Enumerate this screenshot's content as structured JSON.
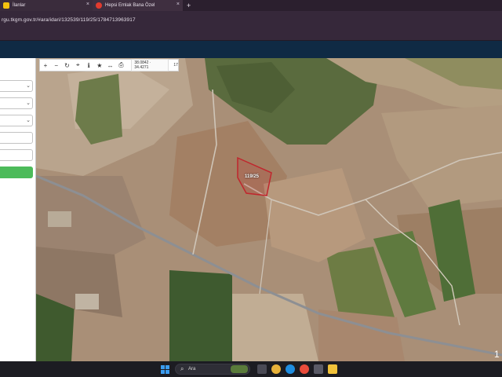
{
  "browser": {
    "tabs": [
      {
        "title": "İlanlar",
        "icon": "sahibinden-icon"
      },
      {
        "title": "Hepsi Emlak Bana Özel",
        "icon": "hepsiemlak-icon"
      }
    ],
    "new_tab_label": "+",
    "tab_close_glyph": "×",
    "url": "rgu.tkgm.gov.tr/#ara/idari/132539/119/25/1784713963917"
  },
  "map": {
    "toolbar": {
      "tools": [
        {
          "name": "zoom-in-icon",
          "glyph": "+"
        },
        {
          "name": "zoom-out-icon",
          "glyph": "−"
        },
        {
          "name": "refresh-icon",
          "glyph": "↻"
        },
        {
          "name": "crosshair-icon",
          "glyph": "⌖"
        },
        {
          "name": "info-icon",
          "glyph": "ℹ"
        },
        {
          "name": "star-icon",
          "glyph": "★"
        },
        {
          "name": "measure-icon",
          "glyph": "↔"
        },
        {
          "name": "print-icon",
          "glyph": "⎙"
        }
      ],
      "coordinates": "38.0842 · 34.4271",
      "zoom": "17"
    },
    "parcel_label": "119/25"
  },
  "sidebar": {
    "query_button_label": ""
  },
  "taskbar": {
    "search_placeholder": "Ara",
    "search_icon": "search-icon",
    "clock_partial": "1"
  },
  "colors": {
    "parcel_outline": "#c0262d",
    "query_button": "#4cbb5a",
    "app_header": "#0f2a44"
  }
}
